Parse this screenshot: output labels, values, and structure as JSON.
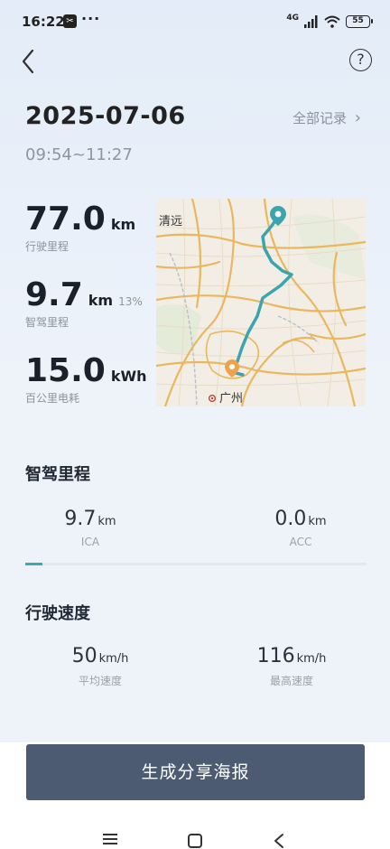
{
  "status_bar": {
    "time": "16:22",
    "dots": "···",
    "network": "4G",
    "battery": "55"
  },
  "header": {
    "help_glyph": "?",
    "date": "2025-07-06",
    "all_records_label": "全部记录",
    "all_records_chevron": "›",
    "time_range": "09:54~11:27"
  },
  "stats": {
    "distance": {
      "value": "77.0",
      "unit": "km",
      "label": "行驶里程"
    },
    "smart_drive": {
      "value": "9.7",
      "unit": "km",
      "percent": "13%",
      "label": "智驾里程"
    },
    "consumption": {
      "value": "15.0",
      "unit": "kWh",
      "label": "百公里电耗"
    }
  },
  "map": {
    "city_north": "清远",
    "city_south": "广州",
    "route_color": "#3aa5ad",
    "start_pin_color": "#3aa5ad",
    "end_pin_color": "#f0a24a"
  },
  "smart_drive_section": {
    "title": "智驾里程",
    "ica": {
      "value": "9.7",
      "unit": "km",
      "label": "ICA"
    },
    "acc": {
      "value": "0.0",
      "unit": "km",
      "label": "ACC"
    },
    "scroll_position": 0
  },
  "speed_section": {
    "title": "行驶速度",
    "avg": {
      "value": "50",
      "unit": "km/h",
      "label": "平均速度"
    },
    "max": {
      "value": "116",
      "unit": "km/h",
      "label": "最高速度"
    }
  },
  "share_button_label": "生成分享海报",
  "accent_color": "#3aaab0"
}
